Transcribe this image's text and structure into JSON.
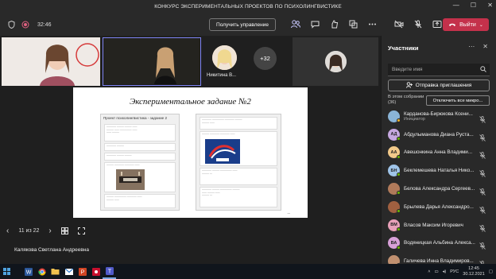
{
  "window": {
    "title": "КОНКУРС ЭКСПЕРИМЕНТАЛЬНЫХ ПРОЕКТОВ ПО ПСИХОЛИНГВИСТИКЕ"
  },
  "toolbar": {
    "timer": "32:46",
    "take_control": "Получить управление",
    "leave": "Выйти"
  },
  "tiles": {
    "overflow_count": "+32",
    "named_tile": "Никитина В..."
  },
  "slide": {
    "title": "Экспериментальное задание №2",
    "form_title": "Проект психолингвистика - задание 2",
    "page": "11 из 22"
  },
  "presenter": {
    "name": "Калякова Светлана Андреевна"
  },
  "panel": {
    "title": "Участники",
    "search_placeholder": "Введите имя",
    "invite": "Отправка приглашения",
    "in_meeting_label": "В этом собрании",
    "in_meeting_count": "(36)",
    "mute_all": "Отключить все микро...",
    "participants": [
      {
        "initials": "",
        "name": "Карданова-Бирюкова Ксени...",
        "role": "Инициатор",
        "avatar_color": "#8ab4d6",
        "status": "#f0b429"
      },
      {
        "initials": "АД",
        "name": "Абдулыманова Диана Руста...",
        "role": "",
        "avatar_color": "#c6a8e0",
        "status": "#6bb700"
      },
      {
        "initials": "АА",
        "name": "Авешонкина Анна Владими...",
        "role": "",
        "avatar_color": "#f2c98a",
        "status": "#6bb700"
      },
      {
        "initials": "БН",
        "name": "Беклемешева Наталья Нико...",
        "role": "",
        "avatar_color": "#9fc4e8",
        "status": "#6bb700"
      },
      {
        "initials": "",
        "name": "Белова Александра Сергеев...",
        "role": "",
        "avatar_color": "#b07a5a",
        "status": "#6bb700"
      },
      {
        "initials": "",
        "name": "Брылева Дарья Александро...",
        "role": "",
        "avatar_color": "#a06040",
        "status": "#6bb700"
      },
      {
        "initials": "ВМ",
        "name": "Власов Максим Игоревич",
        "role": "",
        "avatar_color": "#e8a0b8",
        "status": "#6bb700"
      },
      {
        "initials": "ВА",
        "name": "Водяницкая Альбина Алекса...",
        "role": "",
        "avatar_color": "#d8a0d8",
        "status": "#6bb700"
      },
      {
        "initials": "",
        "name": "Галичева Инна Владимиров...",
        "role": "",
        "avatar_color": "#c09070",
        "status": "#6bb700"
      }
    ]
  },
  "taskbar": {
    "lang": "РУС",
    "time": "12:45",
    "date": "30.12.2021"
  }
}
